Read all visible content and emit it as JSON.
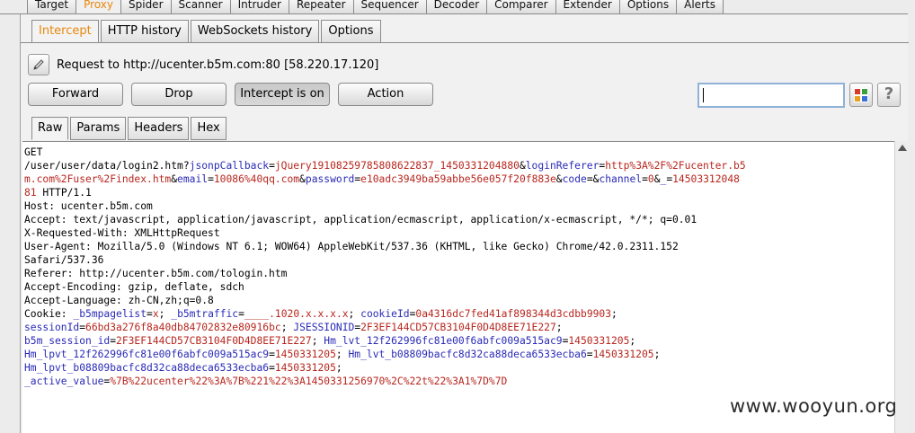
{
  "top_tabs": [
    "Target",
    "Proxy",
    "Spider",
    "Scanner",
    "Intruder",
    "Repeater",
    "Sequencer",
    "Decoder",
    "Comparer",
    "Extender",
    "Options",
    "Alerts"
  ],
  "sub_tabs": [
    "Intercept",
    "HTTP history",
    "WebSockets history",
    "Options"
  ],
  "request": {
    "label": "Request to http://ucenter.b5m.com:80  [58.220.17.120]"
  },
  "buttons": {
    "forward": "Forward",
    "drop": "Drop",
    "intercept": "Intercept is on",
    "action": "Action"
  },
  "search": {
    "value": ""
  },
  "help_label": "?",
  "colors": {
    "accent": "#e8870c",
    "key": "#2a2ab8",
    "value": "#b8261e",
    "grid": [
      "#d83a2c",
      "#3aa23a",
      "#e8a020",
      "#3a6fd8"
    ]
  },
  "view_tabs": [
    "Raw",
    "Params",
    "Headers",
    "Hex"
  ],
  "raw": {
    "method": "GET",
    "l2_path": "/user/user/data/login2.htm?",
    "l2_k1": "jsonpCallback",
    "l2_e1": "=",
    "l2_v1": "jQuery19108259785808622837_1450331204880",
    "l2_a1": "&",
    "l2_k2": "loginReferer",
    "l2_e2": "=",
    "l2_v2": "http%3A%2F%2Fucenter.b5",
    "l3_v2b": "m.com%2Fuser%2Findex.htm",
    "l3_a1": "&",
    "l3_k3": "email",
    "l3_e3": "=",
    "l3_v3": "10086%40qq.com",
    "l3_a2": "&",
    "l3_k4": "password",
    "l3_e4": "=",
    "l3_v4": "e10adc3949ba59abbe56e057f20f883e",
    "l3_a3": "&",
    "l3_k5": "code",
    "l3_e5": "=",
    "l3_a4": "&",
    "l3_k6": "channel",
    "l3_e6": "=",
    "l3_v6": "0",
    "l3_a5": "&",
    "l3_k7": "_",
    "l3_e7": "=",
    "l3_v7": "14503312048",
    "l4_v7b": "81",
    "l4_rest": " HTTP/1.1",
    "host": "Host: ucenter.b5m.com",
    "accept": "Accept: text/javascript, application/javascript, application/ecmascript, application/x-ecmascript, */*; q=0.01",
    "xrw": "X-Requested-With: XMLHttpRequest",
    "ua1": "User-Agent: Mozilla/5.0 (Windows NT 6.1; WOW64) AppleWebKit/537.36 (KHTML, like Gecko) Chrome/42.0.2311.152",
    "ua2": "Safari/537.36",
    "referer": "Referer: http://ucenter.b5m.com/tologin.htm",
    "ae": "Accept-Encoding: gzip, deflate, sdch",
    "al": "Accept-Language: zh-CN,zh;q=0.8",
    "c1_label": "Cookie: ",
    "c1_k1": "_b5mpagelist",
    "c1_e1": "=",
    "c1_v1": "x",
    "c1_s1": "; ",
    "c1_k2": "_b5mtraffic",
    "c1_e2": "=",
    "c1_v2": "____.1020.x.x.x.x",
    "c1_s2": "; ",
    "c1_k3": "cookieId",
    "c1_e3": "=",
    "c1_v3": "0a4316dc7fed41af898344d3cdbb9903",
    "c1_s3": ";",
    "c2_k1": "sessionId",
    "c2_e1": "=",
    "c2_v1": "66bd3a276f8a40db84702832e80916bc",
    "c2_s1": "; ",
    "c2_k2": "JSESSIONID",
    "c2_e2": "=",
    "c2_v2": "2F3EF144CD57CB3104F0D4D8EE71E227",
    "c2_s2": ";",
    "c3_k1": "b5m_session_id",
    "c3_e1": "=",
    "c3_v1": "2F3EF144CD57CB3104F0D4D8EE71E227",
    "c3_s1": "; ",
    "c3_k2": "Hm_lvt_12f262996fc81e00f6abfc009a515ac9",
    "c3_e2": "=",
    "c3_v2": "1450331205",
    "c3_s2": ";",
    "c4_k1": "Hm_lpvt_12f262996fc81e00f6abfc009a515ac9",
    "c4_e1": "=",
    "c4_v1": "1450331205",
    "c4_s1": "; ",
    "c4_k2": "Hm_lvt_b08809bacfc8d32ca88deca6533ecba6",
    "c4_e2": "=",
    "c4_v2": "1450331205",
    "c4_s2": ";",
    "c5_k1": "Hm_lpvt_b08809bacfc8d32ca88deca6533ecba6",
    "c5_e1": "=",
    "c5_v1": "1450331205",
    "c5_s1": ";",
    "c6_k1": "_active_value",
    "c6_e1": "=",
    "c6_v1": "%7B%22ucenter%22%3A%7B%221%22%3A1450331256970%2C%22t%22%3A1%7D%7D"
  },
  "watermark": "www.wooyun.org"
}
